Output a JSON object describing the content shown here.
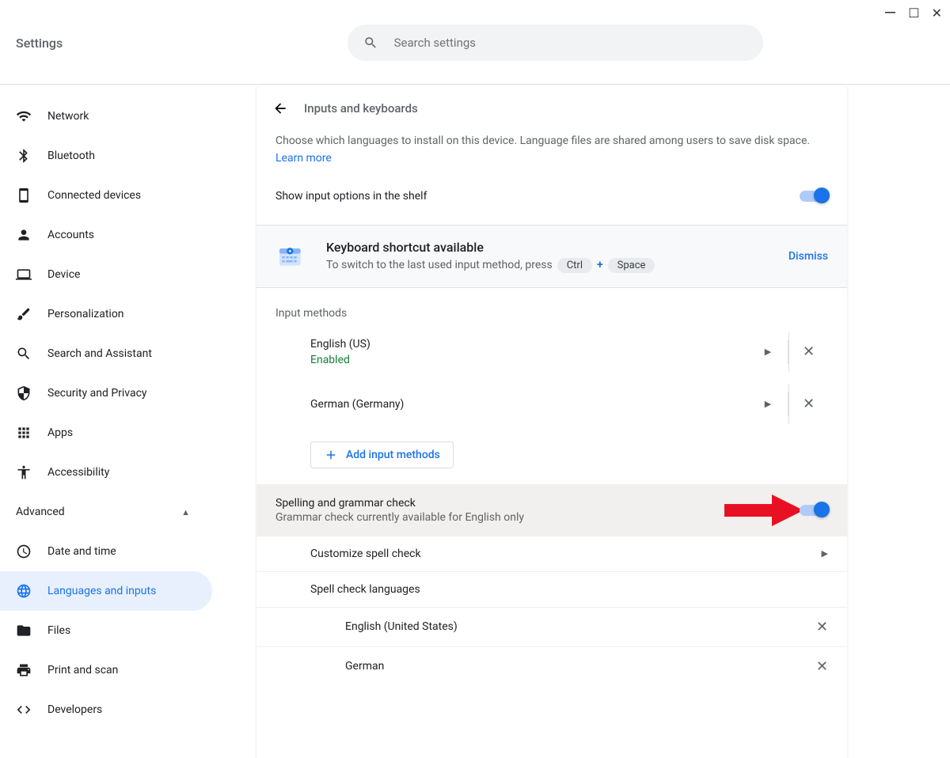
{
  "window": {
    "title": "Settings"
  },
  "header": {
    "search_placeholder": "Search settings"
  },
  "sidebar": {
    "items": [
      {
        "label": "Network",
        "icon": "wifi-icon"
      },
      {
        "label": "Bluetooth",
        "icon": "bluetooth-icon"
      },
      {
        "label": "Connected devices",
        "icon": "phone-icon"
      },
      {
        "label": "Accounts",
        "icon": "person-icon"
      },
      {
        "label": "Device",
        "icon": "laptop-icon"
      },
      {
        "label": "Personalization",
        "icon": "brush-icon"
      },
      {
        "label": "Search and Assistant",
        "icon": "search-icon"
      },
      {
        "label": "Security and Privacy",
        "icon": "shield-icon"
      },
      {
        "label": "Apps",
        "icon": "apps-icon"
      },
      {
        "label": "Accessibility",
        "icon": "accessibility-icon"
      }
    ],
    "advanced_label": "Advanced",
    "advanced_items": [
      {
        "label": "Date and time",
        "icon": "clock-icon"
      },
      {
        "label": "Languages and inputs",
        "icon": "globe-icon",
        "active": true
      },
      {
        "label": "Files",
        "icon": "folder-icon"
      },
      {
        "label": "Print and scan",
        "icon": "print-icon"
      },
      {
        "label": "Developers",
        "icon": "code-icon"
      }
    ]
  },
  "main": {
    "title": "Inputs and keyboards",
    "description": "Choose which languages to install on this device. Language files are shared among users to save disk space.",
    "learn_more": "Learn more",
    "show_input_label": "Show input options in the shelf",
    "shortcut_card": {
      "title": "Keyboard shortcut available",
      "desc": "To switch to the last used input method, press",
      "key1": "Ctrl",
      "plus": "+",
      "key2": "Space",
      "dismiss": "Dismiss"
    },
    "input_methods_label": "Input methods",
    "methods": [
      {
        "name": "English (US)",
        "status": "Enabled"
      },
      {
        "name": "German (Germany)"
      }
    ],
    "add_methods": "Add input methods",
    "spelling": {
      "title": "Spelling and grammar check",
      "sub": "Grammar check currently available for English only"
    },
    "customize_spell": "Customize spell check",
    "spell_lang_label": "Spell check languages",
    "spell_langs": [
      "English (United States)",
      "German"
    ]
  }
}
